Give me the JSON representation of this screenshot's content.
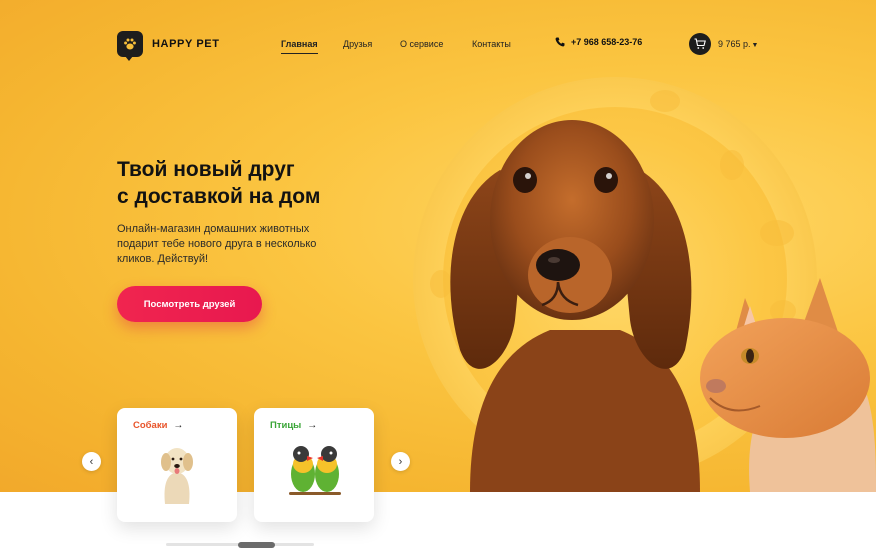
{
  "brand": {
    "name": "HAPPY PET"
  },
  "nav": {
    "items": [
      {
        "label": "Главная",
        "active": true
      },
      {
        "label": "Друзья",
        "active": false
      },
      {
        "label": "О сервисе",
        "active": false
      },
      {
        "label": "Контакты",
        "active": false
      }
    ]
  },
  "contact": {
    "phone": "+7 968 658-23-76"
  },
  "cart": {
    "total": "9 765 р."
  },
  "hero": {
    "title_line1": "Твой новый друг",
    "title_line2": "с доставкой на дом",
    "subtitle": "Онлайн-магазин домашних животных подарит тебе нового друга в несколько кликов. Действуй!",
    "cta_label": "Посмотреть друзей"
  },
  "categories": [
    {
      "label": "Собаки",
      "color": "#e8542a"
    },
    {
      "label": "Птицы",
      "color": "#3aa537"
    }
  ],
  "colors": {
    "accent": "#f0254f",
    "hero_bg": "#fbc541",
    "dark": "#1d1d1d"
  }
}
